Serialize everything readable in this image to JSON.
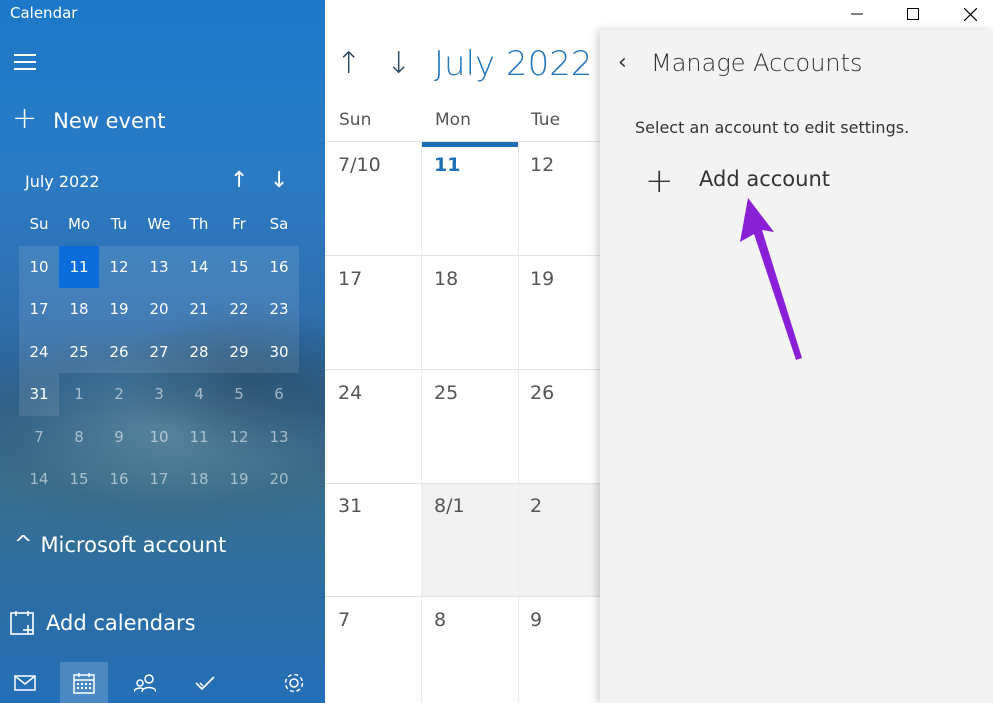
{
  "app": {
    "title": "Calendar"
  },
  "sidebar": {
    "new_event_label": "New event",
    "mini_calendar": {
      "month_label": "July 2022",
      "weekdays": [
        "Su",
        "Mo",
        "Tu",
        "We",
        "Th",
        "Fr",
        "Sa"
      ],
      "weeks": [
        [
          "10",
          "11",
          "12",
          "13",
          "14",
          "15",
          "16"
        ],
        [
          "17",
          "18",
          "19",
          "20",
          "21",
          "22",
          "23"
        ],
        [
          "24",
          "25",
          "26",
          "27",
          "28",
          "29",
          "30"
        ],
        [
          "31",
          "1",
          "2",
          "3",
          "4",
          "5",
          "6"
        ],
        [
          "7",
          "8",
          "9",
          "10",
          "11",
          "12",
          "13"
        ],
        [
          "14",
          "15",
          "16",
          "17",
          "18",
          "19",
          "20"
        ]
      ],
      "selected": "11"
    },
    "account_label": "Microsoft account",
    "add_calendars_label": "Add calendars",
    "bottom_icons": [
      "mail-icon",
      "calendar-icon",
      "people-icon",
      "todo-icon",
      "settings-icon"
    ]
  },
  "main": {
    "title": "July 2022",
    "day_headers": [
      "Sun",
      "Mon",
      "Tue"
    ],
    "rows": [
      [
        "7/10",
        "11",
        "12"
      ],
      [
        "17",
        "18",
        "19"
      ],
      [
        "24",
        "25",
        "26"
      ],
      [
        "31",
        "8/1",
        "2"
      ],
      [
        "7",
        "8",
        "9"
      ]
    ],
    "today": "11"
  },
  "panel": {
    "title": "Manage Accounts",
    "subtitle": "Select an account to edit settings.",
    "add_account_label": "Add account"
  },
  "colors": {
    "accent": "#1f6fb5",
    "arrow": "#8a1fd8"
  }
}
